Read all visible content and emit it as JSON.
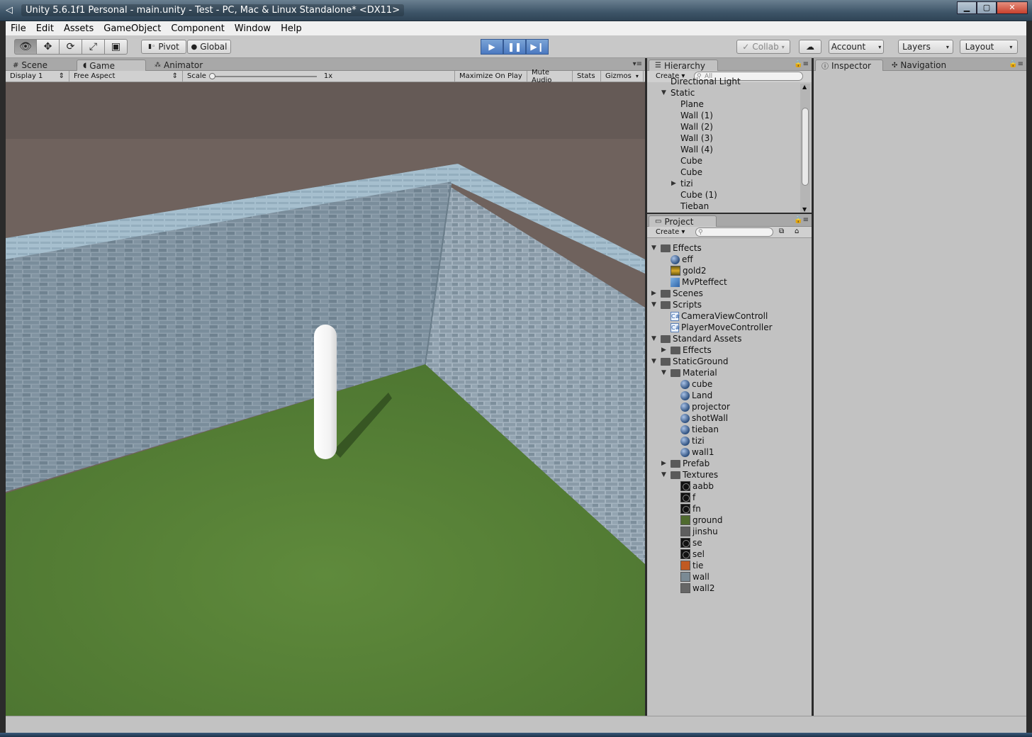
{
  "window": {
    "title": "Unity 5.6.1f1 Personal - main.unity - Test - PC, Mac & Linux Standalone* <DX11>",
    "app_icon": "unity-icon"
  },
  "menu": [
    "File",
    "Edit",
    "Assets",
    "GameObject",
    "Component",
    "Window",
    "Help"
  ],
  "toolbar": {
    "tools": [
      "hand-icon",
      "move-icon",
      "rotate-icon",
      "scale-icon",
      "rect-icon"
    ],
    "pivot_label": "Pivot",
    "global_label": "Global",
    "collab_label": "Collab",
    "account_label": "Account",
    "layers_label": "Layers",
    "layout_label": "Layout"
  },
  "left_tabs": [
    "Scene",
    "Game",
    "Animator"
  ],
  "game_bar": {
    "display": "Display 1",
    "aspect": "Free Aspect",
    "scale_label": "Scale",
    "scale_value": "1x",
    "maximize": "Maximize On Play",
    "mute": "Mute Audio",
    "stats": "Stats",
    "gizmos": "Gizmos"
  },
  "hierarchy": {
    "tab": "Hierarchy",
    "create": "Create",
    "search_placeholder": "All",
    "items": [
      {
        "label": "Directional Light",
        "indent": 1
      },
      {
        "label": "Static",
        "indent": 1,
        "expanded": true
      },
      {
        "label": "Plane",
        "indent": 2
      },
      {
        "label": "Wall (1)",
        "indent": 2
      },
      {
        "label": "Wall (2)",
        "indent": 2
      },
      {
        "label": "Wall (3)",
        "indent": 2
      },
      {
        "label": "Wall (4)",
        "indent": 2
      },
      {
        "label": "Cube",
        "indent": 2
      },
      {
        "label": "Cube",
        "indent": 2
      },
      {
        "label": "tizi",
        "indent": 2,
        "collapsed": true
      },
      {
        "label": "Cube (1)",
        "indent": 2
      },
      {
        "label": "Tieban",
        "indent": 2
      }
    ]
  },
  "project": {
    "tab": "Project",
    "create": "Create",
    "items": [
      {
        "label": "Effects",
        "type": "folder",
        "level": 0,
        "open": true
      },
      {
        "label": "eff",
        "type": "material",
        "level": 1
      },
      {
        "label": "gold2",
        "type": "texture-gold",
        "level": 1
      },
      {
        "label": "MvPteffect",
        "type": "prefab",
        "level": 1
      },
      {
        "label": "Scenes",
        "type": "folder",
        "level": 0,
        "open": false
      },
      {
        "label": "Scripts",
        "type": "folder",
        "level": 0,
        "open": true
      },
      {
        "label": "CameraViewControll",
        "type": "script",
        "level": 1
      },
      {
        "label": "PlayerMoveController",
        "type": "script",
        "level": 1
      },
      {
        "label": "Standard Assets",
        "type": "folder",
        "level": 0,
        "open": true
      },
      {
        "label": "Effects",
        "type": "folder",
        "level": 1,
        "open": false
      },
      {
        "label": "StaticGround",
        "type": "folder",
        "level": 0,
        "open": true
      },
      {
        "label": "Material",
        "type": "folder",
        "level": 1,
        "open": true
      },
      {
        "label": "cube",
        "type": "material",
        "level": 2
      },
      {
        "label": "Land",
        "type": "material",
        "level": 2
      },
      {
        "label": "projector",
        "type": "material",
        "level": 2
      },
      {
        "label": "shotWall",
        "type": "material",
        "level": 2
      },
      {
        "label": "tieban",
        "type": "material",
        "level": 2
      },
      {
        "label": "tizi",
        "type": "material",
        "level": 2
      },
      {
        "label": "wall1",
        "type": "material",
        "level": 2
      },
      {
        "label": "Prefab",
        "type": "folder",
        "level": 1,
        "open": false
      },
      {
        "label": "Textures",
        "type": "folder",
        "level": 1,
        "open": true
      },
      {
        "label": "aabb",
        "type": "texture-dark",
        "level": 2
      },
      {
        "label": "f",
        "type": "texture-dark",
        "level": 2
      },
      {
        "label": "fn",
        "type": "texture-dark",
        "level": 2
      },
      {
        "label": "ground",
        "type": "texture-ground",
        "level": 2
      },
      {
        "label": "jinshu",
        "type": "texture-gray",
        "level": 2
      },
      {
        "label": "se",
        "type": "texture-dark",
        "level": 2
      },
      {
        "label": "sel",
        "type": "texture-dark",
        "level": 2
      },
      {
        "label": "tie",
        "type": "texture-rust",
        "level": 2
      },
      {
        "label": "wall",
        "type": "texture-wall",
        "level": 2
      },
      {
        "label": "wall2",
        "type": "texture-wall2",
        "level": 2
      }
    ]
  },
  "right_tabs": {
    "inspector": "Inspector",
    "navigation": "Navigation"
  }
}
